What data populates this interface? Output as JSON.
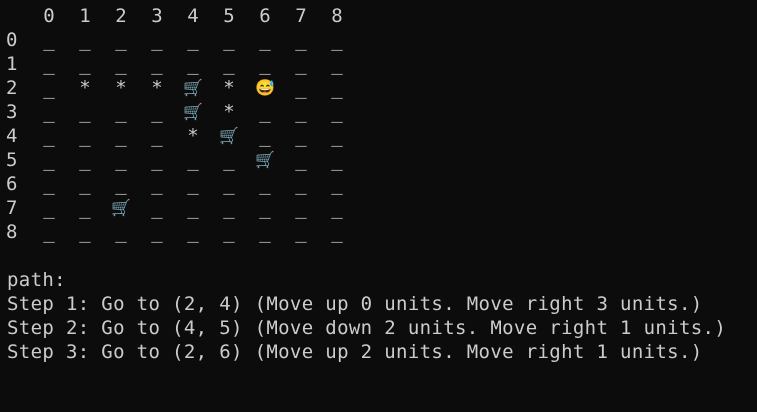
{
  "grid": {
    "col_headers": [
      "0",
      "1",
      "2",
      "3",
      "4",
      "5",
      "6",
      "7",
      "8"
    ],
    "row_headers": [
      "0",
      "1",
      "2",
      "3",
      "4",
      "5",
      "6",
      "7",
      "8"
    ],
    "empty_symbol": "_",
    "visited_symbol": "*",
    "cart_symbol": "🛒",
    "face_symbol": "😅",
    "rows": [
      [
        "_",
        "_",
        "_",
        "_",
        "_",
        "_",
        "_",
        "_",
        "_"
      ],
      [
        "_",
        "_",
        "_",
        "_",
        "_",
        "_",
        "_",
        "_",
        "_"
      ],
      [
        "_",
        "*",
        "*",
        "*",
        "🛒",
        "*",
        "😅",
        "_",
        "_"
      ],
      [
        "_",
        "_",
        "_",
        "_",
        "🛒",
        "*",
        "_",
        "_",
        "_"
      ],
      [
        "_",
        "_",
        "_",
        "_",
        "*",
        "🛒",
        "_",
        "_",
        "_"
      ],
      [
        "_",
        "_",
        "_",
        "_",
        "_",
        "_",
        "🛒",
        "_",
        "_"
      ],
      [
        "_",
        "_",
        "_",
        "_",
        "_",
        "_",
        "_",
        "_",
        "_"
      ],
      [
        "_",
        "_",
        "🛒",
        "_",
        "_",
        "_",
        "_",
        "_",
        "_"
      ],
      [
        "_",
        "_",
        "_",
        "_",
        "_",
        "_",
        "_",
        "_",
        "_"
      ]
    ]
  },
  "path": {
    "heading": "path:",
    "steps": [
      "Step 1: Go to (2, 4) (Move up 0 units. Move right 3 units.)",
      "Step 2: Go to (4, 5) (Move down 2 units. Move right 1 units.)",
      "Step 3: Go to (2, 6) (Move up 2 units. Move right 1 units.)"
    ]
  },
  "colors": {
    "background": "#0c0c0c",
    "foreground": "#cccccc"
  }
}
